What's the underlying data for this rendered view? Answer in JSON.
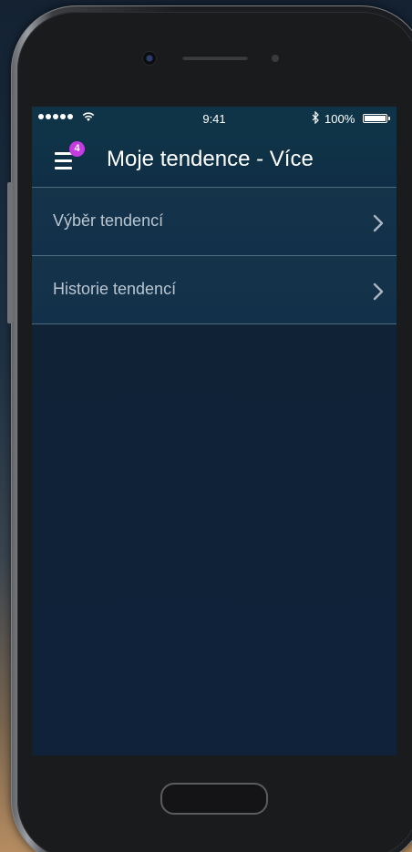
{
  "status_bar": {
    "time": "9:41",
    "battery_percent": "100%",
    "battery_level": 1.0,
    "signal_bars": 5,
    "icons": [
      "signal-dots-icon",
      "wifi-icon",
      "bluetooth-icon",
      "battery-icon"
    ]
  },
  "nav": {
    "title": "Moje tendence - Více",
    "menu_icon": "hamburger-menu-icon",
    "badge_count": "4"
  },
  "list": {
    "items": [
      {
        "label": "Výběr tendencí",
        "icon": "chevron-right-icon"
      },
      {
        "label": "Historie tendencí",
        "icon": "chevron-right-icon"
      }
    ]
  },
  "colors": {
    "header_bg": "#0f3448",
    "screen_bg": "#10223a",
    "badge": "#c43be0",
    "list_text": "#b9c6d1",
    "divider": "#4e6b80"
  }
}
